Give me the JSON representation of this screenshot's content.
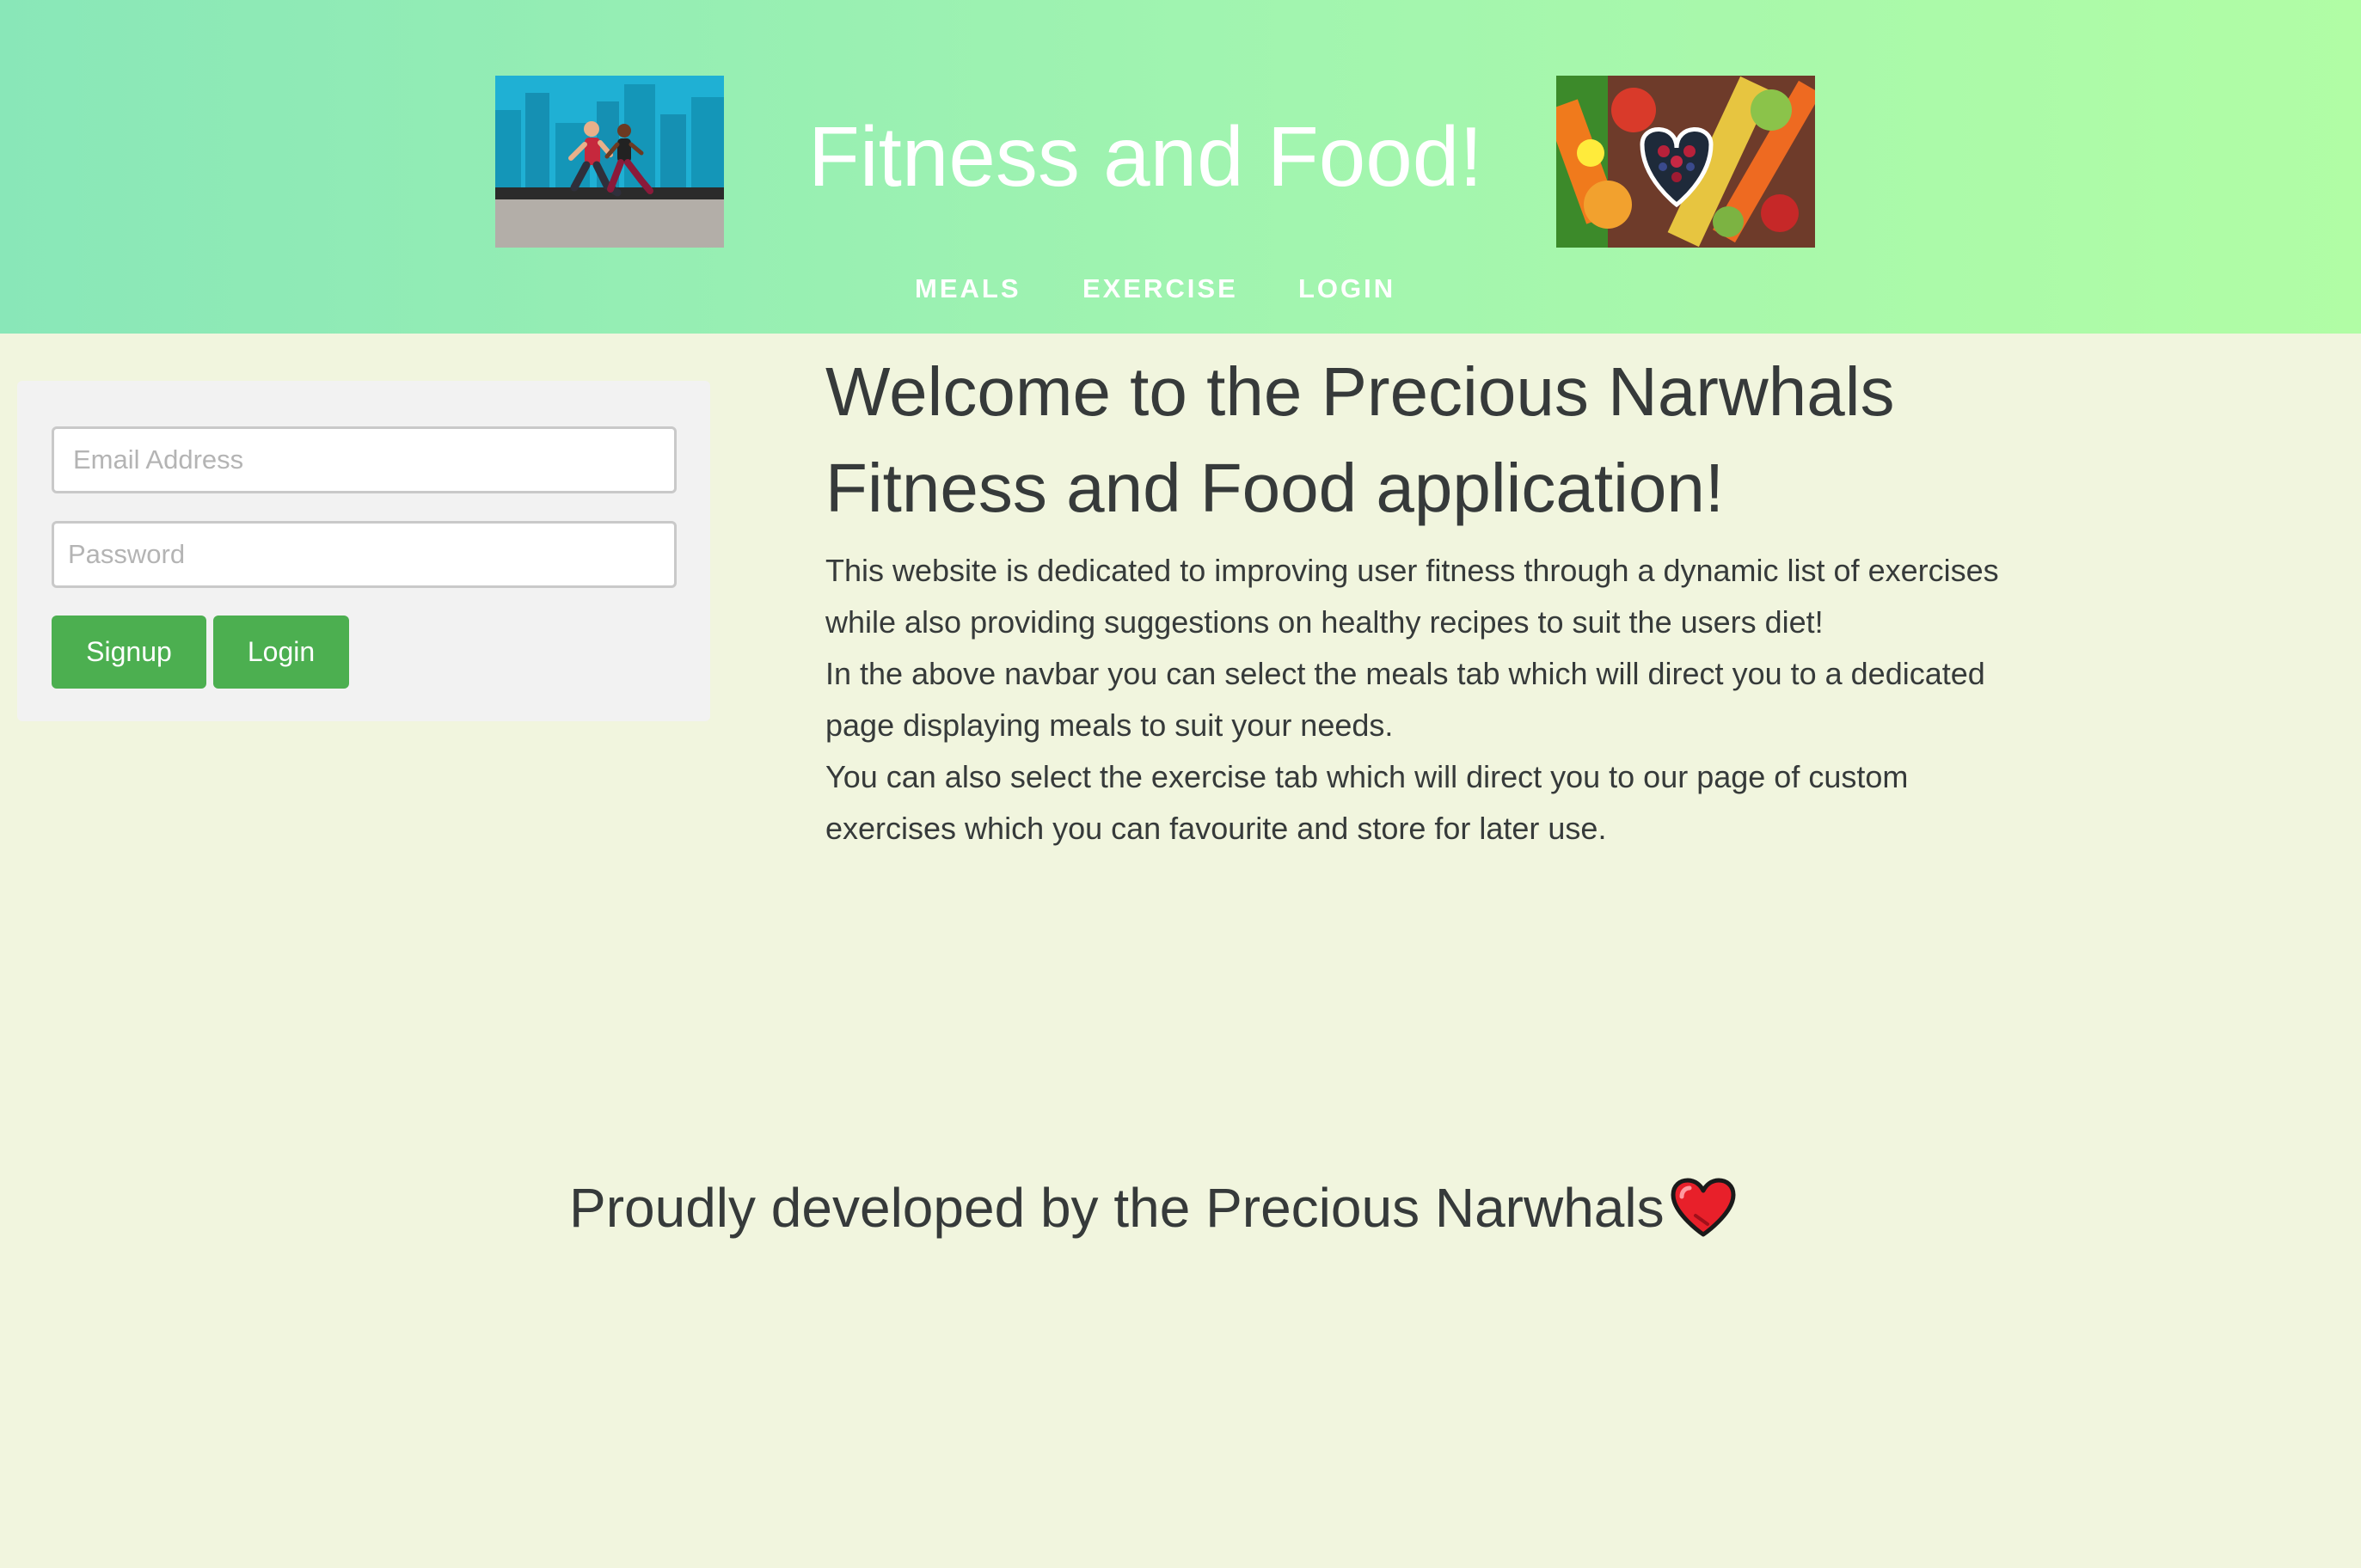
{
  "header": {
    "title": "Fitness and Food!",
    "images": {
      "left": "runners-illustration",
      "right": "vegetables-heart-bowl-photo"
    },
    "nav": [
      {
        "label": "MEALS"
      },
      {
        "label": "EXERCISE"
      },
      {
        "label": "LOGIN"
      }
    ]
  },
  "login_form": {
    "email_placeholder": "Email Address",
    "email_value": "",
    "password_placeholder": "Password",
    "password_value": "",
    "signup_label": "Signup",
    "login_label": "Login"
  },
  "main": {
    "welcome_line1": "Welcome to the Precious Narwhals",
    "welcome_line2": "Fitness and Food application!",
    "paragraphs": [
      "This website is dedicated to improving user fitness through a dynamic list of exercises while also providing suggestions on healthy recipes to suit the users diet!",
      "In the above navbar you can select the meals tab which will direct you to a dedicated page displaying meals to suit your needs.",
      "You can also select the exercise tab which will direct you to our page of custom exercises which you can favourite and store for later use."
    ]
  },
  "footer": {
    "text": "Proudly developed by the Precious Narwhals",
    "icon": "heart-icon"
  },
  "colors": {
    "header_gradient_start": "#89e7b8",
    "header_gradient_end": "#b1fda5",
    "page_background": "#f1f5de",
    "button_green": "#4caf50",
    "heart_red": "#e8202a"
  }
}
